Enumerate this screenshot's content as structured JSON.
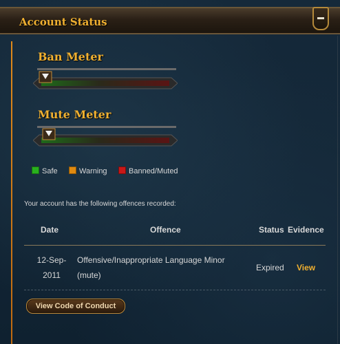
{
  "header": {
    "title": "Account Status",
    "collapse_icon": "minus-icon"
  },
  "meters": [
    {
      "title": "Ban Meter",
      "level": 0.03
    },
    {
      "title": "Mute Meter",
      "level": 0.06
    }
  ],
  "legend": [
    {
      "label": "Safe",
      "color": "#29b01e"
    },
    {
      "label": "Warning",
      "color": "#e08a10"
    },
    {
      "label": "Banned/Muted",
      "color": "#c81818"
    }
  ],
  "offences": {
    "intro": "Your account has the following offences recorded:",
    "columns": {
      "date": "Date",
      "offence": "Offence",
      "status": "Status",
      "evidence": "Evidence"
    },
    "rows": [
      {
        "date_line1": "12-Sep-",
        "date_line2": "2011",
        "offence_line1": "Offensive/Inappropriate Language Minor",
        "offence_line2": "(mute)",
        "status": "Expired",
        "evidence": "View"
      }
    ]
  },
  "actions": {
    "code_of_conduct": "View Code of Conduct"
  }
}
